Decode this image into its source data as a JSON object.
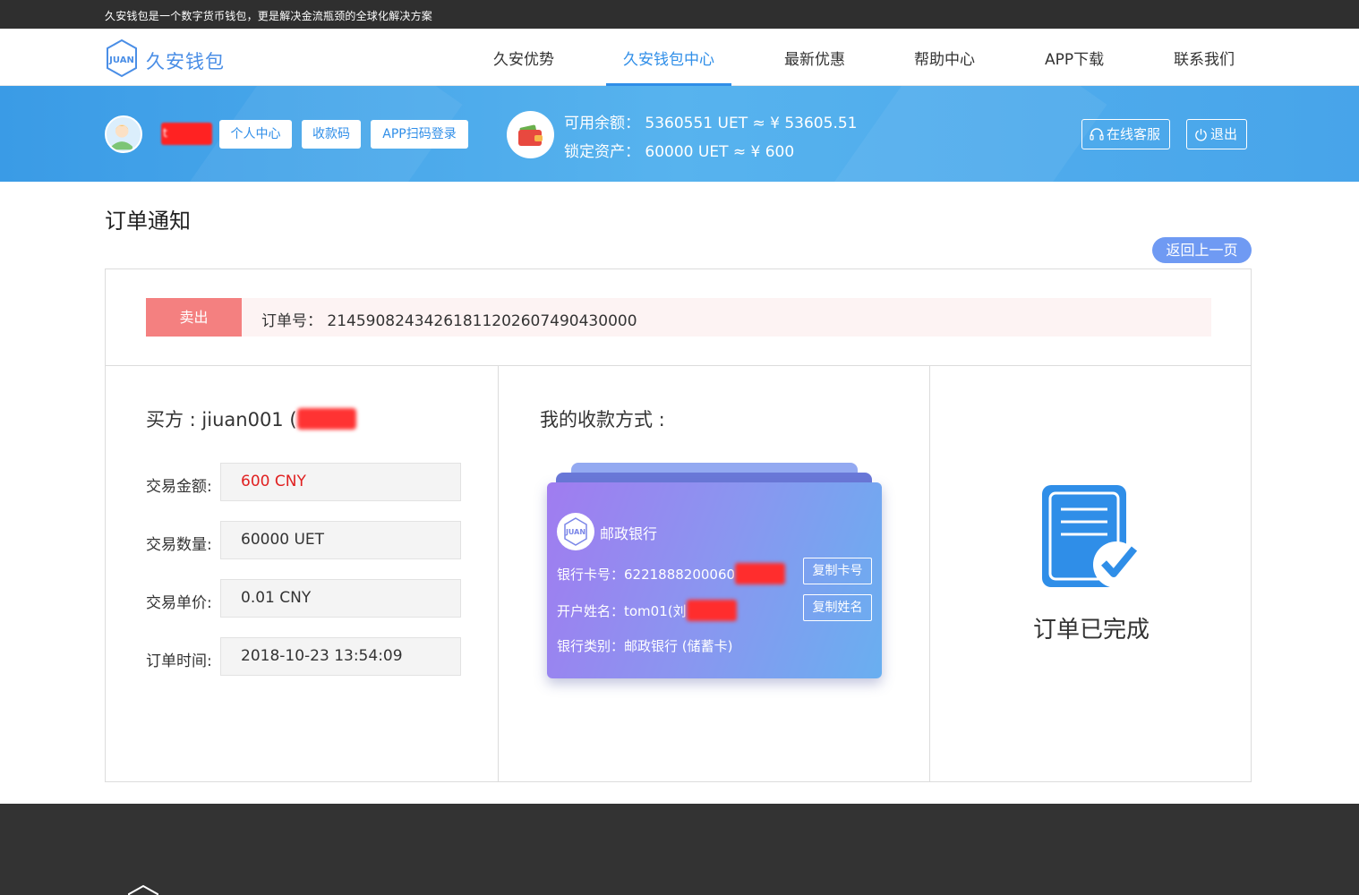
{
  "topbar": {
    "tagline": "久安钱包是一个数字货币钱包，更是解决金流瓶颈的全球化解决方案"
  },
  "logo": {
    "mark_text": "JUAN",
    "brand": "久安钱包"
  },
  "nav": {
    "items": [
      {
        "label": "久安优势",
        "active": false
      },
      {
        "label": "久安钱包中心",
        "active": true
      },
      {
        "label": "最新优惠",
        "active": false
      },
      {
        "label": "帮助中心",
        "active": false
      },
      {
        "label": "APP下载",
        "active": false
      },
      {
        "label": "联系我们",
        "active": false
      }
    ]
  },
  "account": {
    "username_visible": "t",
    "buttons": {
      "personal_center": "个人中心",
      "receive_code": "收款码",
      "app_scan_login": "APP扫码登录"
    },
    "available_balance": "可用余额： 5360551 UET ≈ ¥ 53605.51",
    "locked_assets": "锁定资产： 60000 UET ≈ ¥ 600",
    "online_service": "在线客服",
    "logout": "退出"
  },
  "page": {
    "title": "订单通知",
    "back_button": "返回上一页"
  },
  "order": {
    "type_tag": "卖出",
    "order_number": "订单号： 2145908243426181120260749043000​0"
  },
  "buyer": {
    "label": "买方 : jiuan001 (",
    "fields": [
      {
        "label": "交易金额:",
        "value": "600 CNY",
        "highlight": true
      },
      {
        "label": "交易数量:",
        "value": "60000 UET",
        "highlight": false
      },
      {
        "label": "交易单价:",
        "value": "0.01 CNY",
        "highlight": false
      },
      {
        "label": "订单时间:",
        "value": "2018-10-23 13:54:09",
        "highlight": false
      }
    ]
  },
  "payment": {
    "title": "我的收款方式 :",
    "bank_logo_text": "JUAN",
    "bank_name": "邮政银行",
    "card_number": "银行卡号：6221888200060",
    "account_name": "开户姓名：tom01(刘",
    "bank_type": "银行类别：邮政银行 (储蓄卡)",
    "copy_card": "复制卡号",
    "copy_name": "复制姓名"
  },
  "status": {
    "text": "订单已完成"
  },
  "colors": {
    "primary": "#2f8ee8",
    "band": "#4aa8ea",
    "sell": "#f48080",
    "amount": "#e02020",
    "back_button": "#6f9af3",
    "footer": "#333333"
  }
}
